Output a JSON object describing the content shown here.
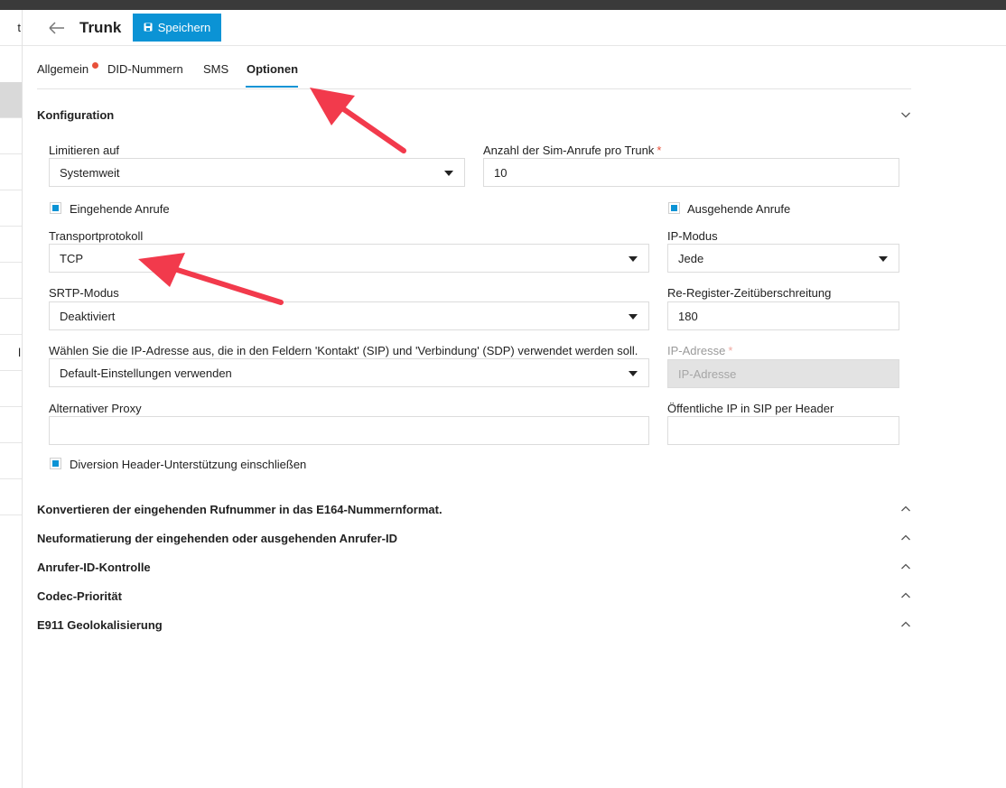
{
  "sidebar": {
    "glyphs": [
      "t",
      "l"
    ]
  },
  "header": {
    "title": "Trunk",
    "save_label": "Speichern"
  },
  "tabs": [
    {
      "label": "Allgemein",
      "has_alert_dot": true
    },
    {
      "label": "DID-Nummern"
    },
    {
      "label": "SMS"
    },
    {
      "label": "Optionen",
      "active": true
    }
  ],
  "konfiguration": {
    "title": "Konfiguration",
    "limitieren_label": "Limitieren auf",
    "limitieren_value": "Systemweit",
    "sim_anrufe_label": "Anzahl der Sim-Anrufe pro Trunk",
    "sim_anrufe_required": "*",
    "sim_anrufe_value": "10",
    "eingehende_label": "Eingehende Anrufe",
    "ausgehende_label": "Ausgehende Anrufe",
    "transport_label": "Transportprotokoll",
    "transport_value": "TCP",
    "ipmodus_label": "IP-Modus",
    "ipmodus_value": "Jede",
    "srtp_label": "SRTP-Modus",
    "srtp_value": "Deaktiviert",
    "reregister_label": "Re-Register-Zeitüberschreitung",
    "reregister_value": "180",
    "ipwahl_label": "Wählen Sie die IP-Adresse aus, die in den Feldern 'Kontakt' (SIP) und 'Verbindung' (SDP) verwendet werden soll.",
    "ipwahl_value": "Default-Einstellungen verwenden",
    "ipadresse_label": "IP-Adresse",
    "ipadresse_required": "*",
    "ipadresse_placeholder": "IP-Adresse",
    "proxy_label": "Alternativer Proxy",
    "proxy_value": "",
    "public_ip_label": "Öffentliche IP in SIP per Header",
    "public_ip_value": "",
    "diversion_label": "Diversion Header-Unterstützung einschließen"
  },
  "sections": [
    "Konvertieren der eingehenden Rufnummer in das E164-Nummernformat.",
    "Neuformatierung der eingehenden oder ausgehenden Anrufer-ID",
    "Anrufer-ID-Kontrolle",
    "Codec-Priorität",
    "E911 Geolokalisierung"
  ],
  "colors": {
    "accent": "#0b93d5",
    "alert": "#e8503a",
    "annotation_arrow": "#f23a4c"
  }
}
